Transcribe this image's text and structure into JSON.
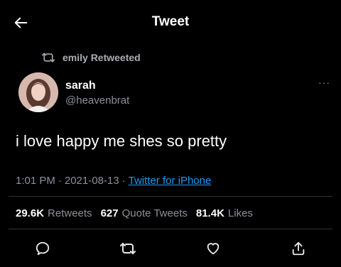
{
  "header": {
    "title": "Tweet"
  },
  "retweet": {
    "text": "emily Retweeted"
  },
  "author": {
    "name": "sarah",
    "handle": "@heavenbrat"
  },
  "tweet": {
    "text": "i love happy me shes so pretty"
  },
  "meta": {
    "time": "1:01 PM",
    "sep1": "·",
    "date": "2021-08-13",
    "sep2": "·",
    "source": "Twitter for iPhone"
  },
  "stats": {
    "retweets_count": "29.6K",
    "retweets_label": "Retweets",
    "quotes_count": "627",
    "quotes_label": "Quote Tweets",
    "likes_count": "81.4K",
    "likes_label": "Likes"
  },
  "more": {
    "label": "···"
  },
  "colors": {
    "background": "#000000",
    "accent": "#1d9bf0",
    "muted": "#8b9096"
  },
  "icons": [
    "back-arrow-icon",
    "retweet-icon",
    "more-icon",
    "reply-icon",
    "retweet-icon",
    "like-icon",
    "share-icon"
  ]
}
